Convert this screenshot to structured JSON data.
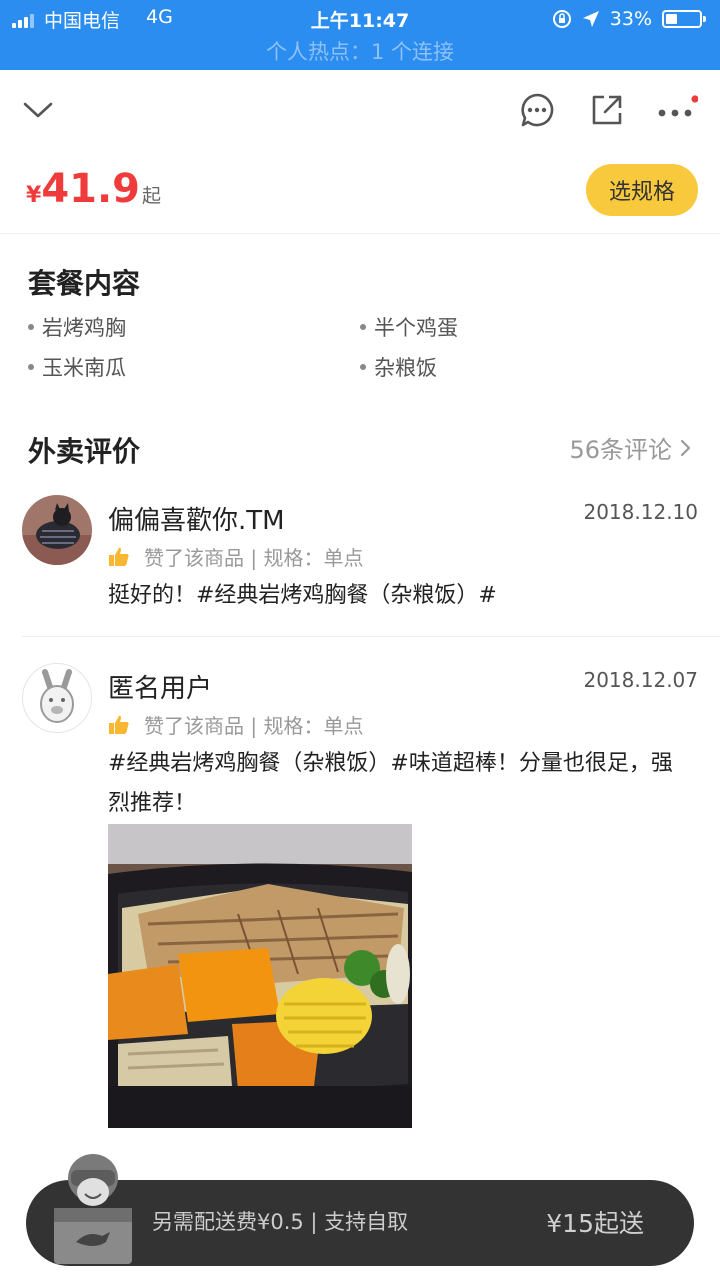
{
  "status_bar": {
    "carrier": "中国电信",
    "network": "4G",
    "time": "上午11:47",
    "battery_percent": "33%",
    "battery_level": 0.33,
    "hotspot": "个人热点：1 个连接"
  },
  "nav": {
    "back_icon": "chevron-down-icon",
    "chat_icon": "chat-bubble-icon",
    "share_icon": "share-icon",
    "more_icon": "more-dots-icon"
  },
  "price": {
    "symbol": "¥",
    "value": "41.9",
    "suffix": "起",
    "spec_button": "选规格"
  },
  "package": {
    "title": "套餐内容",
    "items": [
      "岩烤鸡胸",
      "半个鸡蛋",
      "玉米南瓜",
      "杂粮饭"
    ]
  },
  "reviews": {
    "title": "外卖评价",
    "count_label": "56条评论",
    "items": [
      {
        "user": "偏偏喜歡你.TM",
        "date": "2018.12.10",
        "liked": "赞了该商品 | 规格：单点",
        "text": "挺好的！#经典岩烤鸡胸餐（杂粮饭）#"
      },
      {
        "user": "匿名用户",
        "date": "2018.12.07",
        "liked": "赞了该商品 | 规格：单点",
        "text": "#经典岩烤鸡胸餐（杂粮饭）#味道超棒！分量也很足，强烈推荐！"
      }
    ]
  },
  "bottom_bar": {
    "delivery_info": "另需配送费¥0.5 | 支持自取",
    "min_order": "¥15起送"
  },
  "colors": {
    "status_bar": "#2b8df0",
    "price": "#ef3b3b",
    "spec_button": "#f9c93d",
    "bottom_bar": "#333333"
  }
}
